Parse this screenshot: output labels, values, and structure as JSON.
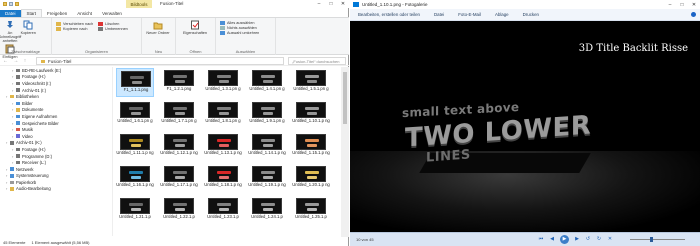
{
  "explorer": {
    "tool_tab": "Bildtools",
    "window_title": "Fusion-Titel",
    "tabs": [
      "Datei",
      "Start",
      "Freigeben",
      "Ansicht",
      "Verwalten"
    ],
    "ribbon": {
      "clipboard": {
        "pin": "An Schnellzugriff anheften",
        "copy": "Kopieren",
        "paste": "Einfügen",
        "label": "Zwischenablage"
      },
      "organize": {
        "move": "Verschieben nach",
        "copy_to": "Kopieren nach",
        "delete": "Löschen",
        "rename": "Umbenennen",
        "label": "Organisieren"
      },
      "new": {
        "folder": "Neuer Ordner",
        "label": "Neu"
      },
      "open": {
        "props": "Eigenschaften",
        "label": "Öffnen"
      },
      "select": {
        "all": "Alles auswählen",
        "none": "Nichts auswählen",
        "invert": "Auswahl umkehren",
        "label": "Auswählen"
      }
    },
    "address": {
      "nav": "← → ↑",
      "path": "Fusion-Titel",
      "search_placeholder": "„Fusion-Titel“ durchsuchen"
    },
    "nav_items": [
      {
        "label": "BD-RE-Laufwerk (E:)",
        "color": "#777"
      },
      {
        "label": "Footage (H:)",
        "color": "#777"
      },
      {
        "label": "Videoschnitt (I:)",
        "color": "#777"
      },
      {
        "label": "Archiv-01 (I:)",
        "color": "#777"
      },
      {
        "label": "Bibliotheken",
        "color": "#e0b64a"
      },
      {
        "label": "Bilder",
        "color": "#4a8fd6"
      },
      {
        "label": "Dokumente",
        "color": "#e0b64a"
      },
      {
        "label": "Eigene Aufnahmen",
        "color": "#4a8fd6"
      },
      {
        "label": "Gespeicherte Bilder",
        "color": "#4a8fd6"
      },
      {
        "label": "Musik",
        "color": "#d65a4a"
      },
      {
        "label": "Video",
        "color": "#6a6ad6"
      },
      {
        "label": "Archiv-01 (K:)",
        "color": "#777"
      },
      {
        "label": "Footage (H:)",
        "color": "#777"
      },
      {
        "label": "Programme (D:)",
        "color": "#777"
      },
      {
        "label": "Receiver (L:)",
        "color": "#777"
      },
      {
        "label": "Netzwerk",
        "color": "#4a8fd6"
      },
      {
        "label": "Systemsteuerung",
        "color": "#4a8fd6"
      },
      {
        "label": "Papierkorb",
        "color": "#999"
      },
      {
        "label": "Audio-Bearbeitung",
        "color": "#e0b64a"
      }
    ],
    "files": [
      [
        "F1_1.1.1.png",
        "F1_1.2.1.png",
        "Untitled_1.3.1.pn g",
        "Untitled_1.4.1.pn g",
        "Untitled_1.5.1.pn g"
      ],
      [
        "Untitled_1.6.1.pn g",
        "Untitled_1.7.1.pn g",
        "Untitled_1.8.1.pn g",
        "Untitled_1.9.1.pn g",
        "Untitled_1.10.1.p ng"
      ],
      [
        "Untitled_1.11.1.p ng",
        "Untitled_1.12.1.p ng",
        "Untitled_1.13.1.p ng",
        "Untitled_1.14.1.p ng",
        "Untitled_1.15.1.p ng"
      ],
      [
        "Untitled_1.16.1.p ng",
        "Untitled_1.17.1.p ng",
        "Untitled_1.18.1.p ng",
        "Untitled_1.19.1.p ng",
        "Untitled_1.20.1.p ng"
      ],
      [
        "Untitled_1.21.1.p",
        "Untitled_1.22.1.p",
        "Untitled_1.23.1.p",
        "Untitled_1.24.1.p",
        "Untitled_1.25.1.p"
      ]
    ],
    "selected_file": "F1_1.1.1.png",
    "status": {
      "count": "45 Elemente",
      "selection": "1 Element ausgewählt (5,56 MB)"
    }
  },
  "photos": {
    "title": "Untitled_1.10.1.png - Fotogalerie",
    "toolbar": [
      "Bearbeiten, erstellen oder teilen",
      "Datei",
      "Foto-E-Mail",
      "Ablage",
      "Drucken"
    ],
    "image": {
      "heading": "3D Title Backlit Risse",
      "line1": "small text above",
      "line2": "TWO LOWER",
      "line3": "LINES"
    },
    "zoom": "10 von 45"
  }
}
